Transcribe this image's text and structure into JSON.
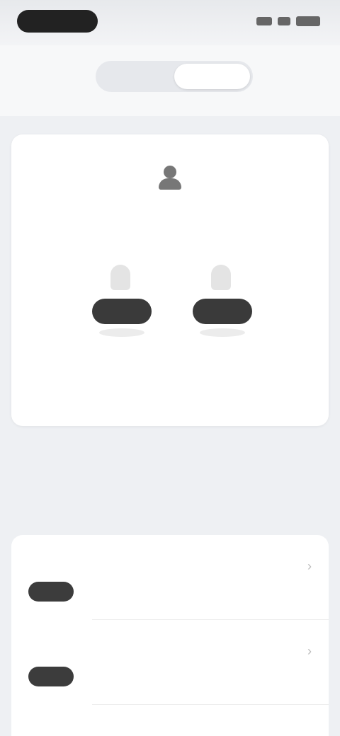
{
  "status_bar": {
    "time": ""
  },
  "header": {
    "tabs": [
      {
        "label": ""
      },
      {
        "label": ""
      }
    ]
  },
  "card": {
    "subtitle": "",
    "devices": [
      {
        "label": ""
      },
      {
        "label": ""
      }
    ]
  },
  "more": {
    "label": ""
  },
  "section": {
    "title": ""
  },
  "list": {
    "items": [
      {
        "title": "",
        "description": ""
      },
      {
        "title": "",
        "description": ""
      }
    ]
  }
}
